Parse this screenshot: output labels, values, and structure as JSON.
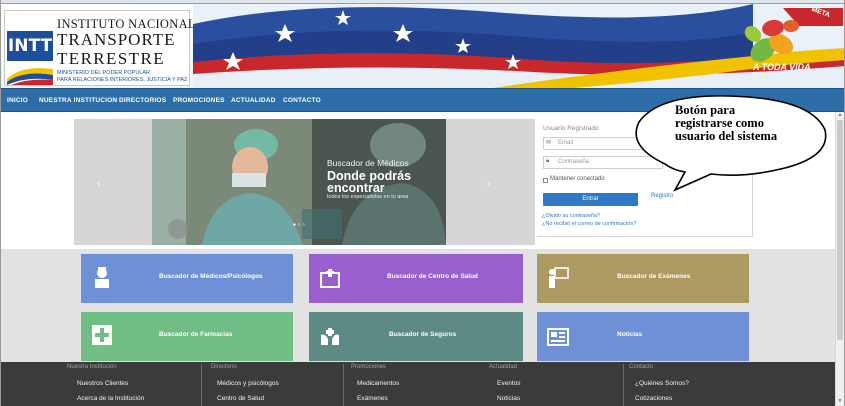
{
  "header": {
    "logo_badge": "INTT",
    "logo_line1": "INSTITUTO NACIONAL DE",
    "logo_line2": "TRANSPORTE",
    "logo_line3": "TERRESTRE",
    "logo_line4": "MINISTERIO DEL PODER POPULAR",
    "logo_line5": "PARA RELACIONES INTERIORES, JUSTICIA Y PAZ",
    "corner_badge": "META",
    "campaign_text": "A TODA VIDA"
  },
  "nav": {
    "items": [
      "INICIO",
      "NUESTRA INSTITUCION",
      "DIRECTORIOS",
      "PROMOCIONES",
      "ACTUALIDAD",
      "CONTACTO"
    ]
  },
  "carousel": {
    "caption_small": "Buscador de Médicos",
    "caption_big": "Donde podrás encontrar",
    "caption_sub": "todos los especialistas en tu area"
  },
  "login": {
    "title": "Usuario Registrado",
    "email_placeholder": "Email",
    "password_placeholder": "Contraseña",
    "remember_label": "Mantener conectado",
    "submit_label": "Entrar",
    "register_label": "Registro",
    "forgot_label": "¿Olvido su contraseña?",
    "resend_label": "¿No recibió el correo de confirmación?"
  },
  "callout": {
    "text": "Botón para registrarse como usuario del sistema"
  },
  "services": [
    {
      "label": "Buscador de Médicos/Psicólogos",
      "color": "#6f8fd6",
      "icon": "doctor-icon"
    },
    {
      "label": "Buscador de Centro de Salud",
      "color": "#9a5fcf",
      "icon": "hospital-icon"
    },
    {
      "label": "Buscador de Exámenes",
      "color": "#ad9a62",
      "icon": "presentation-icon"
    },
    {
      "label": "Buscador de Farmacias",
      "color": "#71bd86",
      "icon": "pharmacy-cross-icon"
    },
    {
      "label": "Buscador de Seguros",
      "color": "#5e8a86",
      "icon": "insurance-hands-icon"
    },
    {
      "label": "Noticias",
      "color": "#6f8fd6",
      "icon": "newspaper-icon"
    }
  ],
  "footer": {
    "columns": [
      {
        "title": "Nuestra Institución",
        "links": [
          "Nuestros Clientes",
          "Acerca de la Institución"
        ]
      },
      {
        "title": "Directorio",
        "links": [
          "Médicos y psicólogos",
          "Centro de Salud"
        ]
      },
      {
        "title": "Promociones",
        "links": [
          "Medicamentos",
          "Exámenes"
        ]
      },
      {
        "title": "Actualidad",
        "links": [
          "Eventos",
          "Noticias"
        ]
      },
      {
        "title": "Contacto",
        "links": [
          "¿Quiénes Somos?",
          "Cotizaciones"
        ]
      }
    ]
  }
}
